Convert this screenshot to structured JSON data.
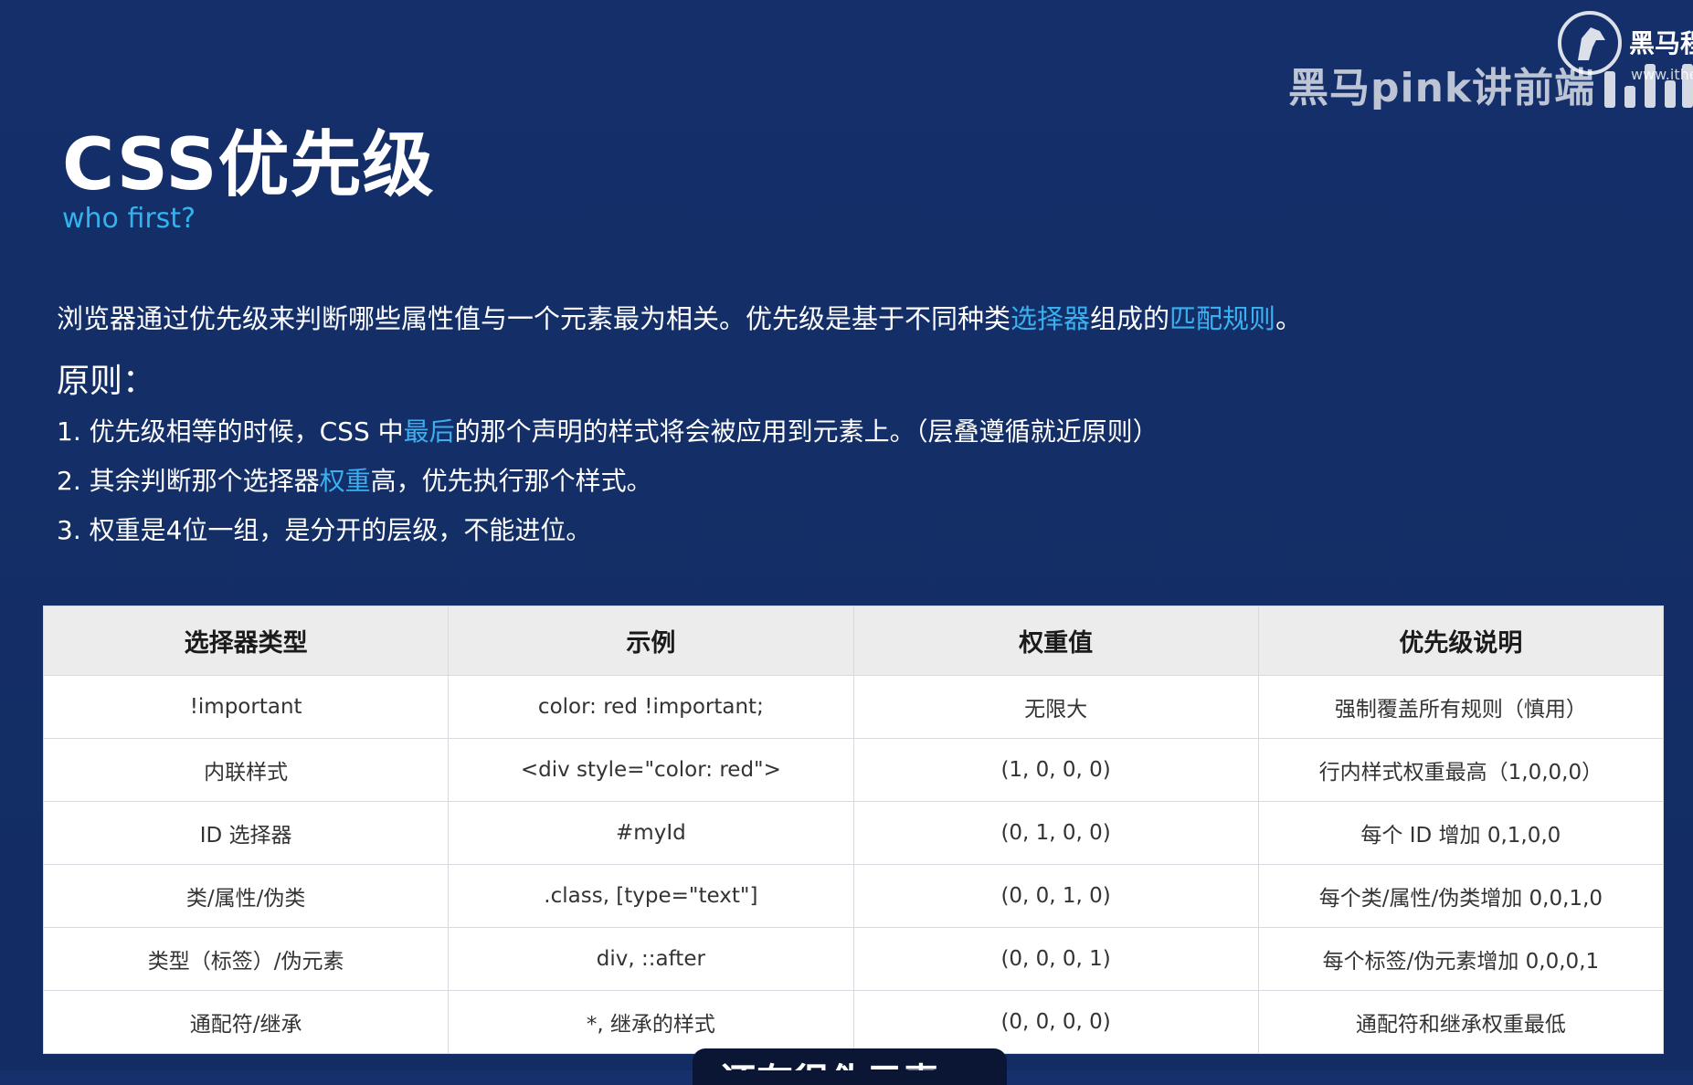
{
  "watermark": {
    "text": "黑马pink讲前端",
    "logo_text": "黑马程",
    "logo_url": "www.ithei"
  },
  "title": "CSS优先级",
  "subtitle": "who first?",
  "intro": {
    "part1": "浏览器通过优先级来判断哪些属性值与一个元素最为相关。优先级是基于不同种类",
    "hl1": "选择器",
    "part2": "组成的",
    "hl2": "匹配规则",
    "part3": "。"
  },
  "principle_heading": "原则：",
  "rules": [
    {
      "before": "1. 优先级相等的时候，CSS 中",
      "highlight": "最后",
      "after": "的那个声明的样式将会被应用到元素上。（层叠遵循就近原则）"
    },
    {
      "before": "2. 其余判断那个选择器",
      "highlight": "权重",
      "after": "高，优先执行那个样式。"
    },
    {
      "before": "3. 权重是4位一组，是分开的层级，不能进位。",
      "highlight": "",
      "after": ""
    }
  ],
  "table": {
    "headers": [
      "选择器类型",
      "示例",
      "权重值",
      "优先级说明"
    ],
    "rows": [
      [
        "!important",
        "color: red !important;",
        "无限大",
        "强制覆盖所有规则（慎用）"
      ],
      [
        "内联样式",
        "<div style=\"color: red\">",
        "(1, 0, 0, 0)",
        "行内样式权重最高（1,0,0,0）"
      ],
      [
        "ID 选择器",
        "#myId",
        "(0, 1, 0, 0)",
        "每个 ID 增加 0,1,0,0"
      ],
      [
        "类/属性/伪类",
        ".class, [type=\"text\"]",
        "(0, 0, 1, 0)",
        "每个类/属性/伪类增加 0,0,1,0"
      ],
      [
        "类型（标签）/伪元素",
        "div, ::after",
        "(0, 0, 0, 1)",
        "每个标签/伪元素增加 0,0,0,1"
      ],
      [
        "通配符/继承",
        "*, 继承的样式",
        "(0, 0, 0, 0)",
        "通配符和继承权重最低"
      ]
    ]
  },
  "caption": "还有很伪元素",
  "colors": {
    "background": "#15306a",
    "highlight": "#3bb0f0",
    "subtitle": "#33b3ee"
  }
}
